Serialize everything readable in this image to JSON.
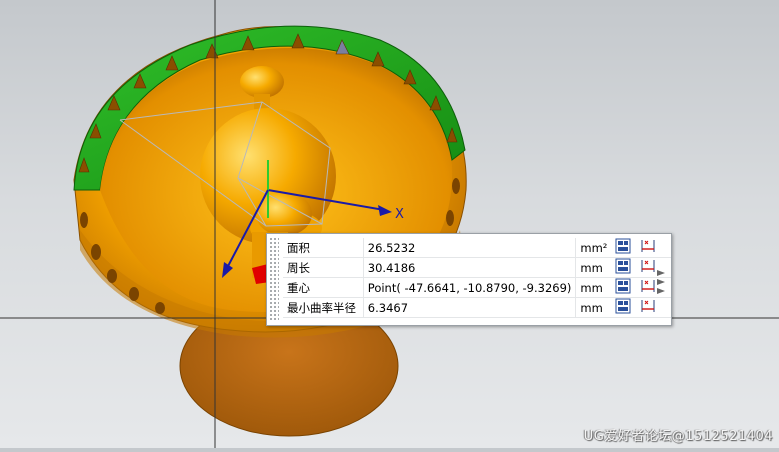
{
  "viewport": {
    "axis_label": "X",
    "colors": {
      "background": "#d4d7da",
      "body_orange": "#f5a400",
      "rim_green": "#22a01e",
      "base_brown": "#b8680a",
      "axis_blue": "#1a1aa8",
      "axis_green": "#2ecc2e",
      "highlight_red": "#e00000"
    }
  },
  "result_panel": {
    "rows": [
      {
        "label": "面积",
        "value": "26.5232",
        "unit": "mm²"
      },
      {
        "label": "周长",
        "value": "30.4186",
        "unit": "mm"
      },
      {
        "label": "重心",
        "value": "Point( -47.6641, -10.8790, -9.3269)",
        "unit": "mm"
      },
      {
        "label": "最小曲率半径",
        "value": "6.3467",
        "unit": "mm"
      }
    ],
    "row_icons": [
      "copy-to-clipboard-icon",
      "create-dimension-icon"
    ],
    "expand_icon": "expand-arrows-icon"
  },
  "watermark": "UG爱好者论坛@1512521404"
}
